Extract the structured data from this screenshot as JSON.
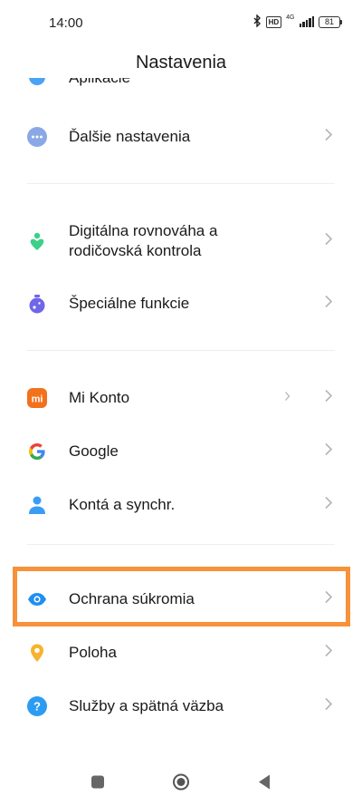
{
  "status_bar": {
    "time": "14:00",
    "network": "4G",
    "battery": "81",
    "icons": [
      "bluetooth-icon",
      "hd-icon",
      "signal-icon",
      "battery-icon"
    ]
  },
  "header": {
    "title": "Nastavenia"
  },
  "cut_off_item": {
    "label": "Aplikácie",
    "icon": "apps-icon"
  },
  "sections": [
    {
      "items": [
        {
          "label": "Ďalšie nastavenia",
          "icon": "more-dots-icon",
          "color": "#8aa8e6"
        }
      ]
    },
    {
      "items": [
        {
          "label": "Digitálna rovnováha a",
          "label2": "rodičovská kontrola",
          "icon": "wellbeing-icon",
          "color": "#3ed08a"
        },
        {
          "label": "Špeciálne funkcie",
          "icon": "special-features-icon",
          "color": "#6f66e8"
        }
      ]
    },
    {
      "items": [
        {
          "label": "Mi Konto",
          "icon": "mi-logo-icon",
          "color": "#f2711c",
          "logo_text": "mi"
        },
        {
          "label": "Google",
          "icon": "google-logo-icon",
          "logo_text": "G"
        },
        {
          "label": "Kontá a synchr.",
          "icon": "accounts-icon",
          "color": "#3a9df5"
        }
      ]
    },
    {
      "items": [
        {
          "label": "Ochrana súkromia",
          "icon": "privacy-eye-icon",
          "color": "#1e8ff0",
          "highlighted": true
        },
        {
          "label": "Poloha",
          "icon": "location-pin-icon",
          "color": "#f7b32b"
        },
        {
          "label": "Služby a spätná väzba",
          "icon": "help-icon",
          "color": "#2c9cf2",
          "icon_glyph": "?"
        }
      ]
    }
  ],
  "highlight_color": "#f7923a",
  "nav_bar": {
    "icons": [
      "recents-square-icon",
      "home-circle-icon",
      "back-triangle-icon"
    ]
  }
}
